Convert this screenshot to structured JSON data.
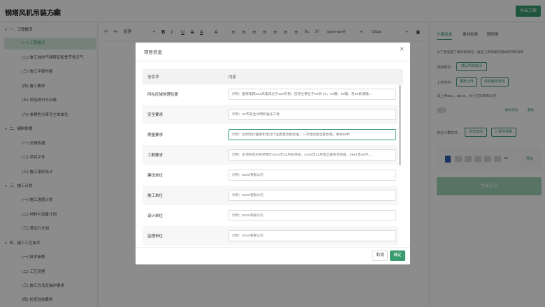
{
  "header": {
    "title": "钢塔风机吊装方案",
    "export_label": "导出方案"
  },
  "sidebar": {
    "items": [
      {
        "label": "一、工程概况",
        "level": 1,
        "expanded": true
      },
      {
        "label": "(一) 工程概况",
        "level": 2,
        "active": true
      },
      {
        "label": "(二) 施工地的气候特征和季节性天气",
        "level": 2
      },
      {
        "label": "(三) 施工平面布置",
        "level": 2
      },
      {
        "label": "(四) 施工要求",
        "level": 2
      },
      {
        "label": "(五) 风险辨识与分级",
        "level": 2
      },
      {
        "label": "(六) 参建各方责任主体单位",
        "level": 2
      },
      {
        "label": "二、编制依据",
        "level": 1,
        "expanded": true
      },
      {
        "label": "(一) 法律依据",
        "level": 2
      },
      {
        "label": "(二) 项目文件",
        "level": 2
      },
      {
        "label": "(三) 施工组织设计",
        "level": 2
      },
      {
        "label": "三、施工计划",
        "level": 1,
        "expanded": true
      },
      {
        "label": "(一) 施工进度计划",
        "level": 2
      },
      {
        "label": "(二) 材料与设备计划",
        "level": 2
      },
      {
        "label": "(三) 劳动力计划",
        "level": 2
      },
      {
        "label": "四、施工工艺技术",
        "level": 1,
        "expanded": true
      },
      {
        "label": "(一) 技术参数",
        "level": 2
      },
      {
        "label": "(二) 工艺流程",
        "level": 2
      },
      {
        "label": "(三) 施工方法及操作要求",
        "level": 2
      },
      {
        "label": "(四) 检查验收要求",
        "level": 2
      }
    ]
  },
  "toolbar": {
    "heading": "段落",
    "font": "sans-serif",
    "size": "16px",
    "buttons": [
      "B",
      "I",
      "U",
      "S",
      "A",
      "A",
      "≡",
      "≡",
      "≡",
      "≡",
      "≡",
      "≡",
      "≡",
      "X₂",
      "X²"
    ]
  },
  "right_panel": {
    "tabs": [
      "方案目录",
      "素材检索",
      "联网搜"
    ],
    "hint": "为了更全面了解项目情况，请您上传或填写相关的项目资料",
    "overview_label": "项目概况:",
    "overview_button": "填写项目概况",
    "upload_label": "上传附件:",
    "upload_button": "重新上传",
    "parse_button": "获取解析状态",
    "format_hint": "请上传doc、docx，大小在50MB以内",
    "parse_status": "解析成功",
    "delete_label": "删除",
    "safety_label": "安全计算软件:",
    "launch_button": "点击启动",
    "calc_button": "计算书获取",
    "file_suffix": "xx",
    "preview_label": "预览",
    "generate_button": "生成全文"
  },
  "modal": {
    "title": "项目信息",
    "col_field": "信息项",
    "col_content": "内容",
    "cancel_label": "取消",
    "ok_label": "确定",
    "rows": [
      {
        "label": "所在区域地理位置",
        "placeholder": "示例：国家电网xxx风电场位于xxx东部，区域主要位于xx县 xx、xx镇、xx镇、及xx县城镇..."
      },
      {
        "label": "安全要求",
        "placeholder": "示例：xx市安全文明标准化工地"
      },
      {
        "label": "质量要求",
        "placeholder": "示例：达到现行国家和电力行业质量合格标准，一次性验收全部合格，争创xx杯",
        "focused": true
      },
      {
        "label": "工期要求",
        "placeholder": "示例：本项目风机吊装预计xxxx年xx月初开始，xxxx年xx月底全部吊装完成，xxxx年xx月..."
      },
      {
        "label": "建设单位",
        "placeholder": "示例：xxxx有限公司"
      },
      {
        "label": "施工单位",
        "placeholder": "示例：xxxx有限公司"
      },
      {
        "label": "设计单位",
        "placeholder": "示例：xxxx有限公司"
      },
      {
        "label": "监理单位",
        "placeholder": "示例：xxxx有限公司"
      }
    ]
  }
}
